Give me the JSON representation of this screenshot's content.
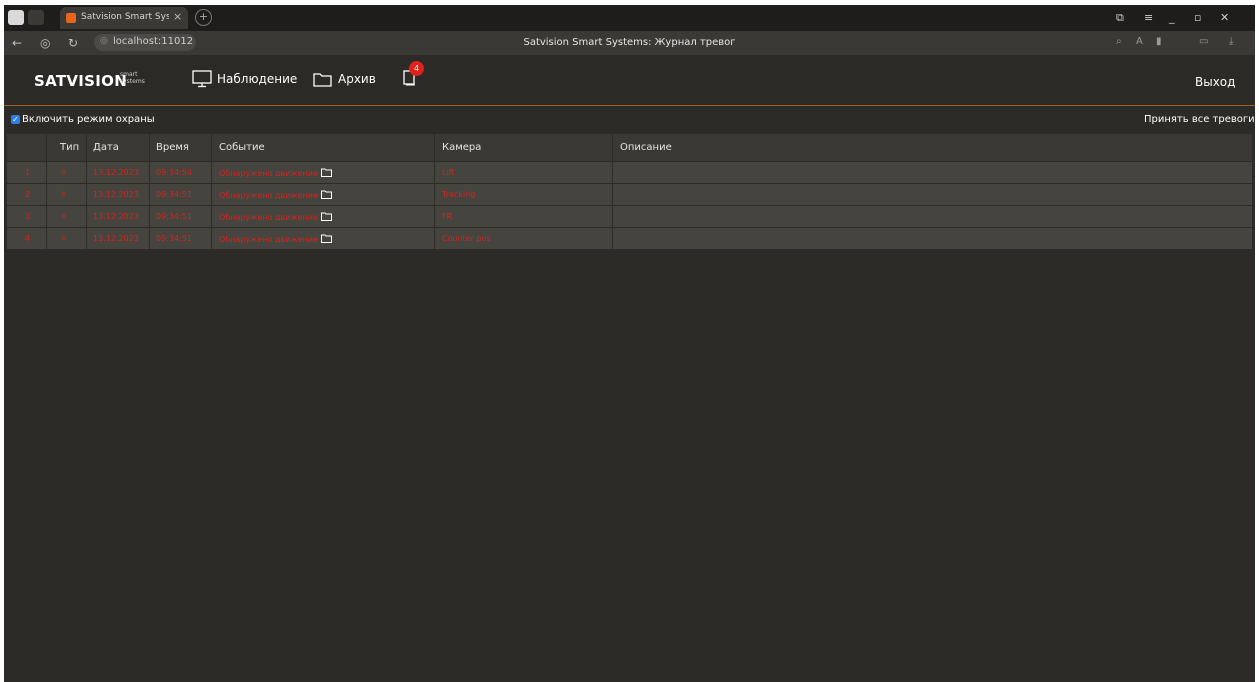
{
  "browser": {
    "tab_title": "Satvision Smart Systems",
    "tab_close": "×",
    "new_tab": "+",
    "url": "localhost:11012",
    "page_title": "Satvision Smart Systems: Журнал тревог"
  },
  "app": {
    "logo": "SATVISION",
    "logo_small": "smart systems",
    "nav": {
      "monitoring": "Наблюдение",
      "archive": "Архив"
    },
    "alarm_count": "4",
    "exit": "Выход"
  },
  "toolbar": {
    "guard_mode_label": "Включить режим охраны",
    "guard_mode_checked": true,
    "accept_all": "Принять все тревоги"
  },
  "table": {
    "headers": [
      "",
      "Тип",
      "Дата",
      "Время",
      "Событие",
      "Камера",
      "Описание"
    ],
    "rows": [
      {
        "n": "1",
        "date": "13.12.2023",
        "time": "09:34:54",
        "event": "Обнаружено движение",
        "camera": "Lift",
        "desc": ""
      },
      {
        "n": "2",
        "date": "13.12.2023",
        "time": "09:34:51",
        "event": "Обнаружено движение",
        "camera": "Tracking",
        "desc": ""
      },
      {
        "n": "3",
        "date": "13.12.2023",
        "time": "09:34:51",
        "event": "Обнаружено движение",
        "camera": "FR",
        "desc": ""
      },
      {
        "n": "4",
        "date": "13.12.2023",
        "time": "09:34:51",
        "event": "Обнаружено движение",
        "camera": "Counter pos",
        "desc": ""
      }
    ]
  },
  "colors": {
    "alarm_red": "#d1261f",
    "accent_orange": "#a0622a",
    "background": "#2c2b27"
  }
}
